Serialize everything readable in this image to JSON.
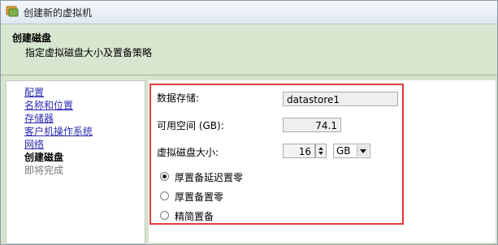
{
  "window": {
    "title": "创建新的虚拟机"
  },
  "header": {
    "heading": "创建磁盘",
    "subtitle": "指定虚拟磁盘大小及置备策略"
  },
  "sidebar": {
    "items": [
      {
        "label": "配置",
        "state": "link"
      },
      {
        "label": "名称和位置",
        "state": "link"
      },
      {
        "label": "存储器",
        "state": "link"
      },
      {
        "label": "客户机操作系统",
        "state": "link"
      },
      {
        "label": "网络",
        "state": "link"
      },
      {
        "label": "创建磁盘",
        "state": "current"
      },
      {
        "label": "即将完成",
        "state": "disabled"
      }
    ]
  },
  "form": {
    "datastore_label": "数据存储:",
    "datastore_value": "datastore1",
    "free_space_label": "可用空间 (GB):",
    "free_space_value": "74.1",
    "disk_size_label": "虚拟磁盘大小:",
    "disk_size_value": "16",
    "disk_size_unit": "GB",
    "provisioning_options": [
      {
        "label": "厚置备延迟置零",
        "selected": true
      },
      {
        "label": "厚置备置零",
        "selected": false
      },
      {
        "label": "精简置备",
        "selected": false
      }
    ]
  },
  "colors": {
    "highlight_border": "#e33a3a",
    "header_bg": "#d7e6cf",
    "link": "#2b2bb0"
  }
}
